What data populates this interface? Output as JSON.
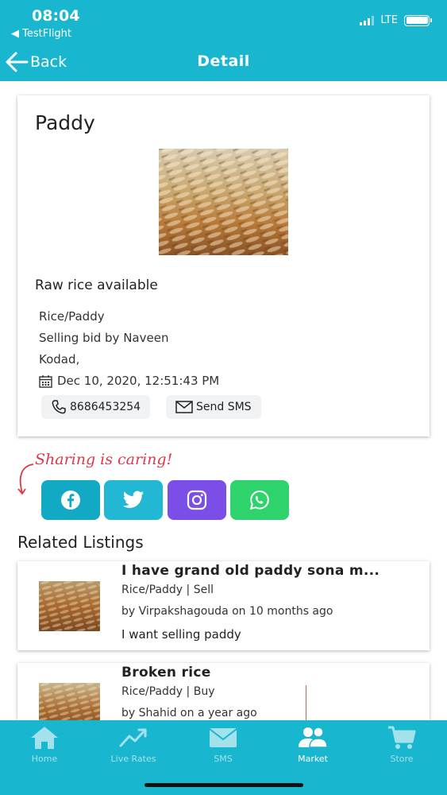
{
  "status": {
    "time": "08:04",
    "back_app": "◀ TestFlight",
    "network": "LTE"
  },
  "nav": {
    "back_label": "Back",
    "title": "Detail"
  },
  "listing": {
    "title": "Paddy",
    "description": "Raw rice available",
    "category": "Rice/Paddy",
    "bid": "Selling bid by Naveen",
    "location": "Kodad,",
    "date": "Dec 10, 2020, 12:51:43 PM",
    "phone": "8686453254",
    "sms_label": "Send SMS"
  },
  "sharing": {
    "caption": "Sharing is caring!",
    "buttons": [
      {
        "name": "facebook",
        "color": "#12a9c4"
      },
      {
        "name": "twitter",
        "color": "#22b8d3"
      },
      {
        "name": "instagram",
        "color": "#7b4ee8"
      },
      {
        "name": "whatsapp",
        "color": "#2fd36b"
      }
    ]
  },
  "related": {
    "heading": "Related Listings",
    "items": [
      {
        "title": "I have grand old paddy sona m...",
        "category": "Rice/Paddy | Sell",
        "by": "by Virpakshagouda on 10 months ago",
        "desc": "I want selling paddy"
      },
      {
        "title": "Broken rice",
        "category": "Rice/Paddy | Buy",
        "by": "by Shahid on a year ago",
        "desc": ""
      }
    ]
  },
  "tabs": [
    {
      "label": "Home",
      "icon": "home-icon"
    },
    {
      "label": "Live Rates",
      "icon": "trend-icon"
    },
    {
      "label": "SMS",
      "icon": "mail-icon"
    },
    {
      "label": "Market",
      "icon": "users-icon"
    },
    {
      "label": "Store",
      "icon": "cart-icon"
    }
  ],
  "colors": {
    "primary": "#19b6cf",
    "sharing_text": "#e0384a"
  }
}
